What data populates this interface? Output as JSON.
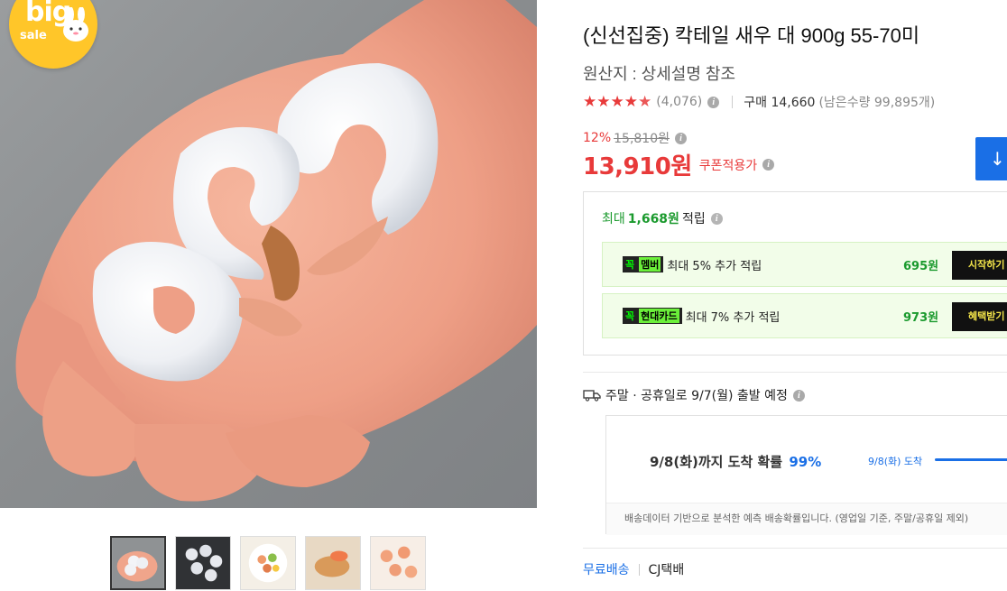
{
  "badge": {
    "big": "big",
    "sale": "sale"
  },
  "product": {
    "title": "(신선집중) 칵테일 새우 대 900g 55-70미",
    "origin": "원산지 : 상세설명 참조"
  },
  "rating": {
    "stars": 4.8,
    "review_count": "(4,076)",
    "purchase": "구매 14,660",
    "remaining": "(남은수량 99,895개)"
  },
  "price": {
    "discount_rate": "12%",
    "original": "15,810원",
    "sale": "13,910원",
    "coupon_label": "쿠폰적용가"
  },
  "reward": {
    "head_prefix": "최대",
    "head_amount": "1,668원",
    "head_suffix": "적립",
    "items": [
      {
        "tag_check": "꼭",
        "tag_label": "멤버",
        "desc": "최대 5% 추가 적립",
        "amount": "695원",
        "button": "시작하기"
      },
      {
        "tag_check": "꼭",
        "tag_label": "현대카드",
        "desc": "최대 7% 추가 적립",
        "amount": "973원",
        "button": "혜택받기"
      }
    ]
  },
  "shipping": {
    "notice": "주말 · 공휴일로 9/7(월) 출발 예정",
    "predict_main": "9/8(화)까지 도착 확률",
    "predict_pct": "99%",
    "predict_side": "9/8(화) 도착",
    "predict_note": "배송데이터 기반으로 분석한 예측 배송확률입니다. (영업일 기준, 주말/공휴일 제외)"
  },
  "delivery": {
    "free": "무료배송",
    "carrier": "CJ택배"
  },
  "colors": {
    "accent_red": "#e83a3a",
    "accent_blue": "#1a6fe6",
    "reward_green": "#1b9a2e",
    "badge_yellow": "#ffc629"
  }
}
